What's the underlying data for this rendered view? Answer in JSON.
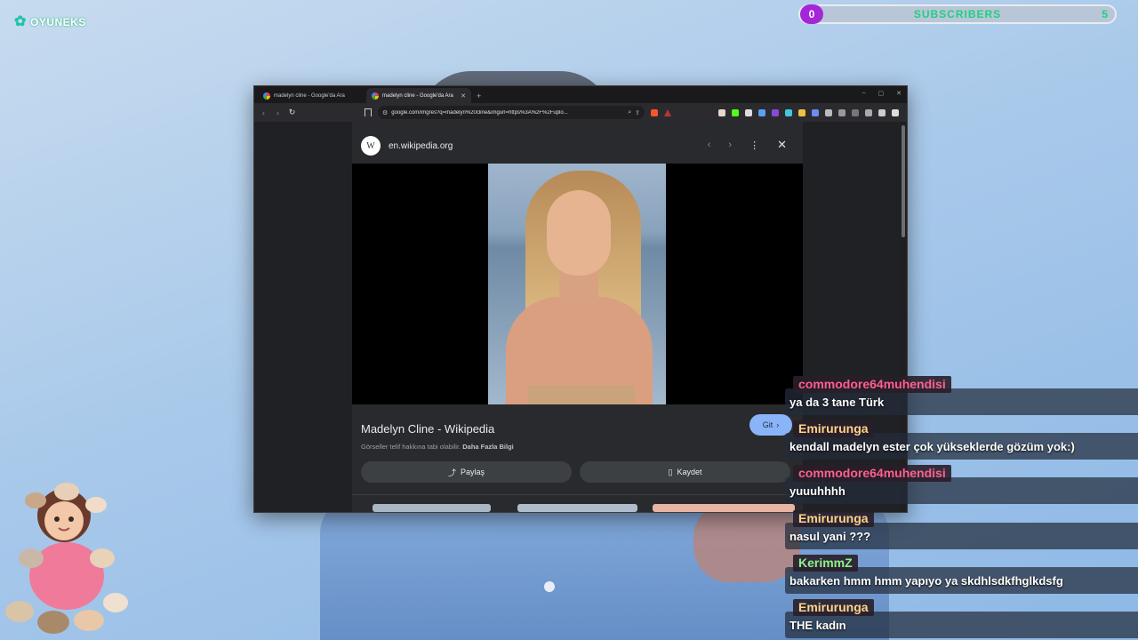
{
  "stream": {
    "logo_text": "OYUNEKS",
    "subscribers": {
      "current": "0",
      "label": "SUBSCRIBERS",
      "goal": "5"
    }
  },
  "browser": {
    "tabs": [
      {
        "title": "madelyn cline - Google'da Ara",
        "active": false
      },
      {
        "title": "madelyn cline - Google'da Ara",
        "active": true
      }
    ],
    "new_tab_glyph": "+",
    "window_controls": [
      "–",
      "▢",
      "✕"
    ],
    "address_url": "google.com/imgres?q=madelyn%20cline&imgurl=https%3A%2F%2Fuplo...",
    "image_panel": {
      "source_initial": "W",
      "source_name": "en.wikipedia.org",
      "title": "Madelyn Cline - Wikipedia",
      "go_button": "Git",
      "copyright_note": "Görseller telif hakkına tabi olabilir.",
      "more_info": "Daha Fazla Bilgi",
      "share_button": "Paylaş",
      "save_button": "Kaydet"
    }
  },
  "chat": [
    {
      "user": "commodore64muhendisi",
      "color": "#ff5f8f",
      "message": "ya da 3 tane Türk"
    },
    {
      "user": "Emirurunga",
      "color": "#ffd38a",
      "message": "kendall madelyn ester çok yükseklerde gözüm yok:)"
    },
    {
      "user": "commodore64muhendisi",
      "color": "#ff5f8f",
      "message": "yuuuhhhh"
    },
    {
      "user": "Emirurunga",
      "color": "#ffd38a",
      "message": "nasul yani ???"
    },
    {
      "user": "KerimmZ",
      "color": "#8ff08a",
      "message": "bakarken hmm hmm yapıyo ya skdhlsdkfhglkdsfg"
    },
    {
      "user": "Emirurunga",
      "color": "#ffd38a",
      "message": "THE kadın"
    }
  ]
}
